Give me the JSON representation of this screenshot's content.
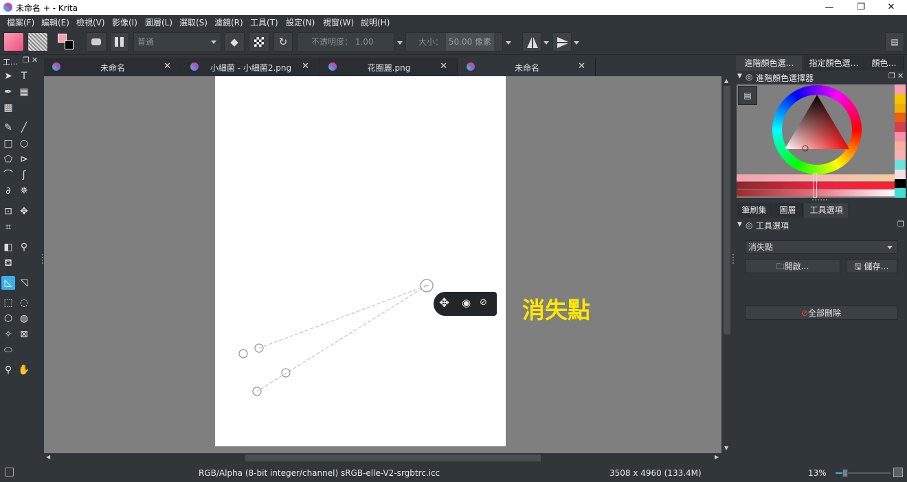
{
  "window": {
    "title": "未命名 + - Krita",
    "controls": [
      "—",
      "❐",
      "✕"
    ]
  },
  "menu": [
    "檔案(F)",
    "編輯(E)",
    "檢視(V)",
    "影像(I)",
    "圖層(L)",
    "選取(S)",
    "濾鏡(R)",
    "工具(T)",
    "設定(N)",
    "視窗(W)",
    "說明(H)"
  ],
  "toolbar": {
    "blend_mode": "普通",
    "opacity_label": "不透明度：",
    "opacity_value": "1.00",
    "size_label": "大小：",
    "size_value": "50.00 像素"
  },
  "toolbox": {
    "title": "工…"
  },
  "tabs": [
    {
      "label": "未命名"
    },
    {
      "label": "小細菌 - 小細菌2.png"
    },
    {
      "label": "花圈麗.png"
    },
    {
      "label": "未命名"
    }
  ],
  "annotation": {
    "text": "消失點",
    "color": "#ffe800"
  },
  "dock": {
    "top_tabs": [
      "進階顏色選…",
      "指定顏色選…",
      "顏色…"
    ],
    "color_selector_title": "進階顏色選擇器",
    "palette": [
      "#f7a0b0",
      "#f5c400",
      "#f0b000",
      "#e86010",
      "#d83c50",
      "#f590a8",
      "#f7b0a0",
      "#f5b0b8",
      "#6ae4d8",
      "#f2e0e4",
      "#000000",
      "#40e0d0"
    ],
    "bottom_tabs": [
      "筆刷集",
      "圖層",
      "工具選項"
    ],
    "tool_options_title": "工具選項",
    "assistant_type": "消失點",
    "open_button": "開啟…",
    "save_button": "儲存…",
    "delete_all_button": "全部刪除"
  },
  "status": {
    "color_space": "RGB/Alpha (8-bit integer/channel)  sRGB-elle-V2-srgbtrc.icc",
    "dimensions": "3508 x 4960 (133.4M)",
    "zoom": "13%"
  },
  "colors": {
    "accent": "#3daee9",
    "canvas_bg": "#7f7f7f",
    "ui_bg": "#31363b"
  }
}
